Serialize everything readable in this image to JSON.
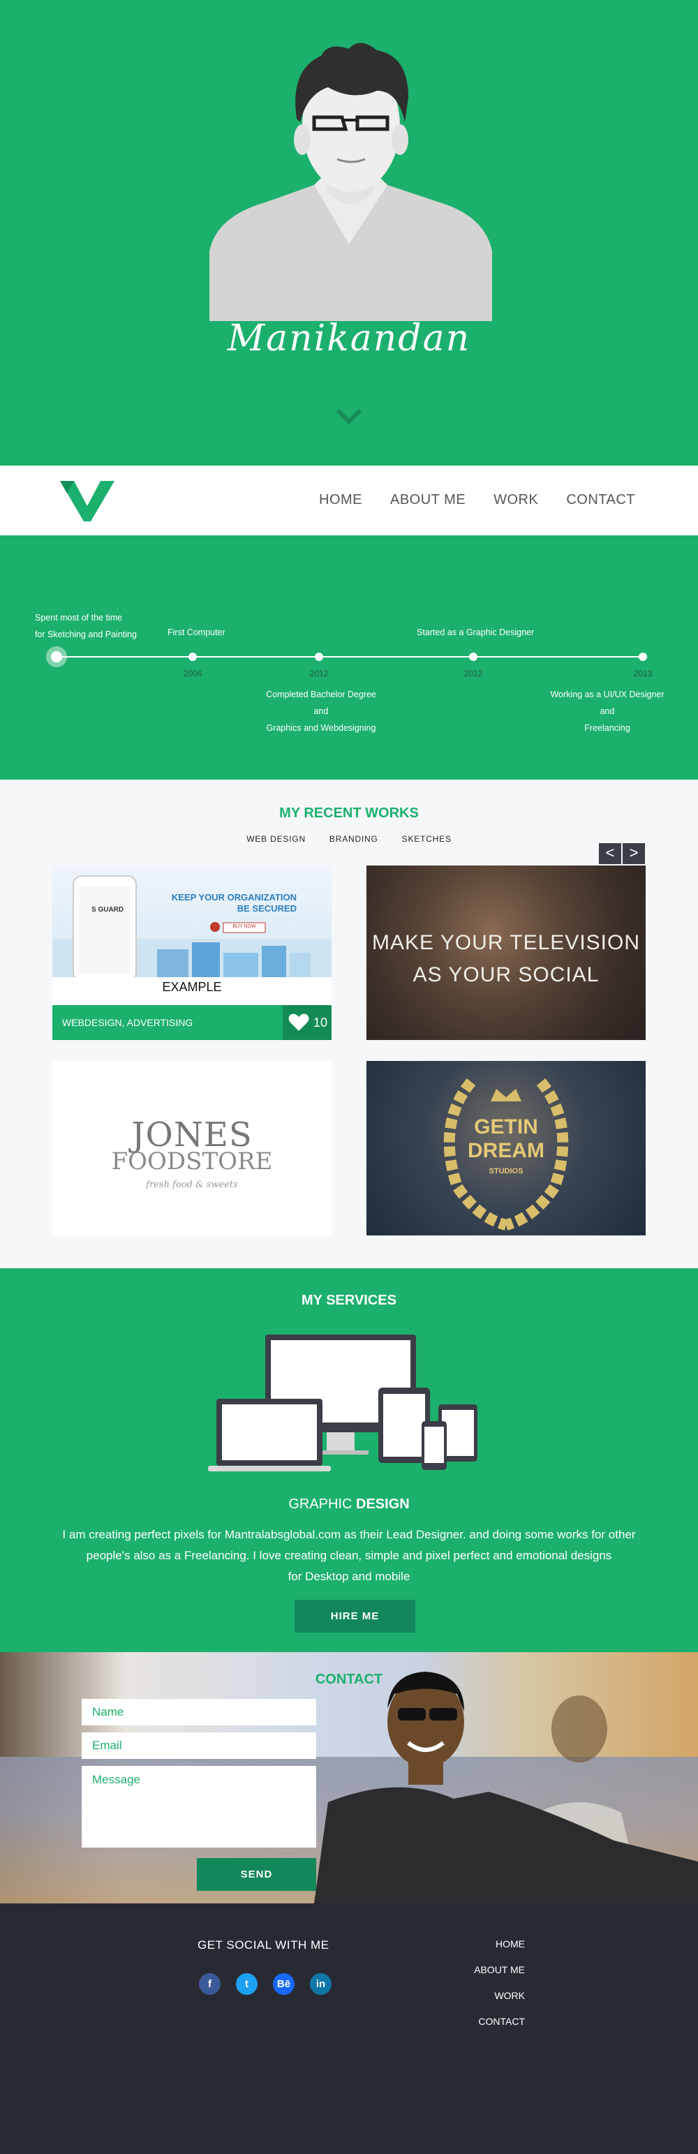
{
  "hero": {
    "name": "Manikandan"
  },
  "nav": {
    "items": [
      "HOME",
      "ABOUT ME",
      "WORK",
      "CONTACT"
    ]
  },
  "timeline": {
    "start": "Spent most of the time for Sketching and Painting",
    "start_line1": "Spent most of the time",
    "start_line2": "for Sketching and Painting",
    "first_computer": "First Computer",
    "graphic_designer": "Started as a Graphic Designer",
    "degree_line1": "Completed Bachelor Degree",
    "degree_line2": "and",
    "degree_line3": "Graphics and Webdesigning",
    "uiux_line1": "Working as a UI/UX Designer",
    "uiux_line2": "and",
    "uiux_line3": "Freelancing",
    "years": [
      "2006",
      "2012",
      "2012",
      "2013"
    ]
  },
  "works": {
    "title": "MY RECENT WORKS",
    "filters": [
      "WEB DESIGN",
      "BRANDING",
      "SKETCHES"
    ],
    "prev": "<",
    "next": ">",
    "card1": {
      "headline1": "KEEP YOUR ORGANIZATION",
      "headline2": "BE SECURED",
      "button": "BUY NOW",
      "brand": "S GUARD",
      "caption": "EXAMPLE",
      "tags": "WEBDESIGN, ADVERTISING",
      "likes": "10"
    },
    "card2": {
      "line1": "MAKE YOUR TELEVISION",
      "line2": "AS YOUR SOCIAL"
    },
    "card3": {
      "line1": "JONES",
      "line2": "FOODSTORE",
      "line3": "fresh food & sweets"
    },
    "card4": {
      "line1": "GETIN",
      "line2": "DREAM",
      "line3": "STUDIOS"
    }
  },
  "services": {
    "title": "MY SERVICES",
    "subtitle_light": "GRAPHIC ",
    "subtitle_bold": "DESIGN",
    "line1": "I am creating perfect pixels for Mantralabsglobal.com as their Lead Designer. and doing some works for other",
    "line2": "people's also as a Freelancing. I love creating clean, simple and pixel perfect and emotional designs",
    "line3": "for Desktop and mobile",
    "button": "HIRE ME"
  },
  "contact": {
    "title": "CONTACT",
    "name_placeholder": "Name",
    "email_placeholder": "Email",
    "message_placeholder": "Message",
    "button": "SEND"
  },
  "footer": {
    "social_title": "GET SOCIAL WITH ME",
    "social": [
      {
        "icon": "facebook-icon",
        "glyph": "f",
        "color": "#3b5998"
      },
      {
        "icon": "twitter-icon",
        "glyph": "t",
        "color": "#1da1f2"
      },
      {
        "icon": "behance-icon",
        "glyph": "Bē",
        "color": "#1769ff"
      },
      {
        "icon": "linkedin-icon",
        "glyph": "in",
        "color": "#0e76a8"
      }
    ],
    "links": [
      "HOME",
      "ABOUT ME",
      "WORK",
      "CONTACT"
    ]
  },
  "colors": {
    "accent": "#1bb06c",
    "dark": "#272a32",
    "button": "#11875a"
  }
}
